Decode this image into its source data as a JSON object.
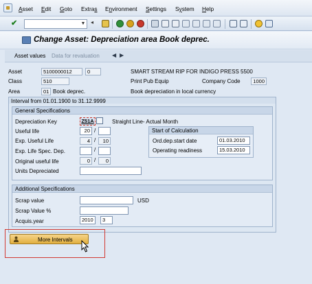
{
  "menu": {
    "items": [
      "Asset",
      "Edit",
      "Goto",
      "Extras",
      "Environment",
      "Settings",
      "System",
      "Help"
    ],
    "underline": [
      "A",
      "E",
      "G",
      "s",
      "n",
      "S",
      "y",
      "H"
    ]
  },
  "toolbar": {
    "command_field_value": "",
    "icons": [
      "enter-icon",
      "save-icon",
      "back-icon",
      "exit-icon",
      "cancel-icon",
      "print-icon",
      "find-icon",
      "find-next-icon",
      "first-page-icon",
      "prev-page-icon",
      "next-page-icon",
      "last-page-icon",
      "new-session-icon",
      "shortcut-icon",
      "help-icon",
      "layout-icon"
    ]
  },
  "title": "Change Asset:  Depreciation area Book deprec.",
  "app_toolbar": {
    "asset_values": "Asset values",
    "data_for_revaluation": "Data for revaluation"
  },
  "header": {
    "asset_label": "Asset",
    "asset_number": "5100000012",
    "sub_number": "0",
    "asset_description": "SMART STREAM RIP FOR INDIGO PRESS 5500",
    "class_label": "Class",
    "class_value": "510",
    "class_description": "Print Pub Equip",
    "company_code_label": "Company Code",
    "company_code_value": "1000",
    "area_label": "Area",
    "area_value": "01",
    "area_name": "Book deprec.",
    "area_description": "Book depreciation in local currency"
  },
  "interval": "Interval from 01.01.1900 to 31.12.9999",
  "general": {
    "title": "General Specifications",
    "dep_key_label": "Depreciation Key",
    "dep_key_value": "Z51A",
    "dep_key_text": "Straight Line- Actual Month",
    "useful_life_label": "Useful life",
    "useful_life_years": "20",
    "useful_life_periods": "",
    "exp_useful_life_label": "Exp. Useful Life",
    "exp_useful_life_years": "4",
    "exp_useful_life_periods": "10",
    "exp_life_spec_label": "Exp. Life Spec. Dep.",
    "exp_life_spec_years": "",
    "exp_life_spec_periods": "",
    "orig_useful_life_label": "Original useful life",
    "orig_useful_life_years": "0",
    "orig_useful_life_periods": "0",
    "units_dep_label": "Units Depreciated",
    "units_dep_value": "",
    "slash": "/"
  },
  "start_calc": {
    "title": "Start of Calculation",
    "ord_dep_label": "Ord.dep.start date",
    "ord_dep_value": "01.03.2010",
    "op_readiness_label": "Operating readiness",
    "op_readiness_value": "15.03.2010"
  },
  "additional": {
    "title": "Additional Specifications",
    "scrap_value_label": "Scrap value",
    "scrap_value_value": "",
    "currency": "USD",
    "scrap_pct_label": "Scrap Value %",
    "scrap_pct_value": "",
    "acquis_year_label": "Acquis.year",
    "acquis_year_value": "2010",
    "acquis_period_value": "3"
  },
  "more_intervals_label": "More Intervals",
  "colors": {
    "highlight": "#d23a32",
    "button": "#e2b040"
  }
}
